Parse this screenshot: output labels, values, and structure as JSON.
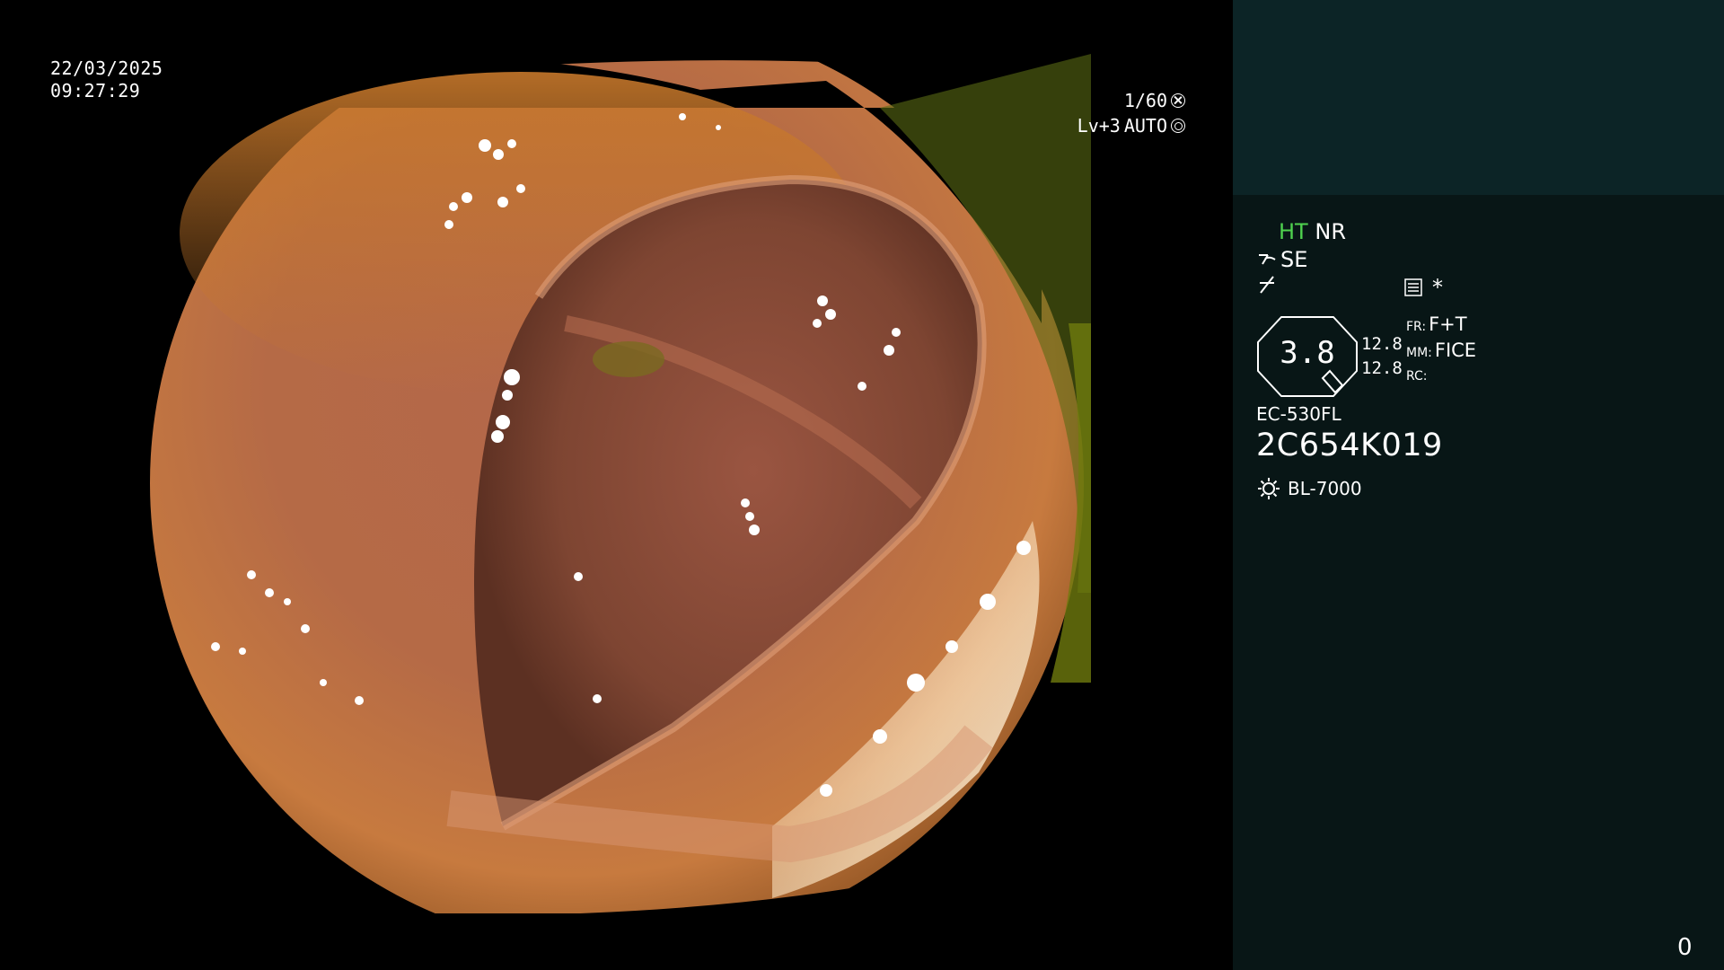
{
  "overlay": {
    "date": "22/03/2025",
    "time": "09:27:29",
    "shutter": "1/60",
    "level": "Lv+3",
    "exposure": "AUTO"
  },
  "panel": {
    "ht": "HT",
    "nr": "NR",
    "se": "SE",
    "gauge_value": "3.8",
    "num_top": "12.8",
    "num_bottom": "12.8",
    "fr_key": "FR:",
    "fr_val": "F+T",
    "mm_key": "MM:",
    "mm_val": "FICE",
    "rc_key": "RC:",
    "scope_model": "EC-530FL",
    "scope_serial": "2C654K019",
    "light_source": "BL-7000",
    "asterisk": "*",
    "counter": "0"
  },
  "icons": {
    "shutter": "shutter-icon",
    "iris": "iris-icon",
    "structure": "structure-enhance-icon",
    "freeze": "freeze-icon",
    "menu": "menu-icon",
    "light": "light-icon"
  }
}
